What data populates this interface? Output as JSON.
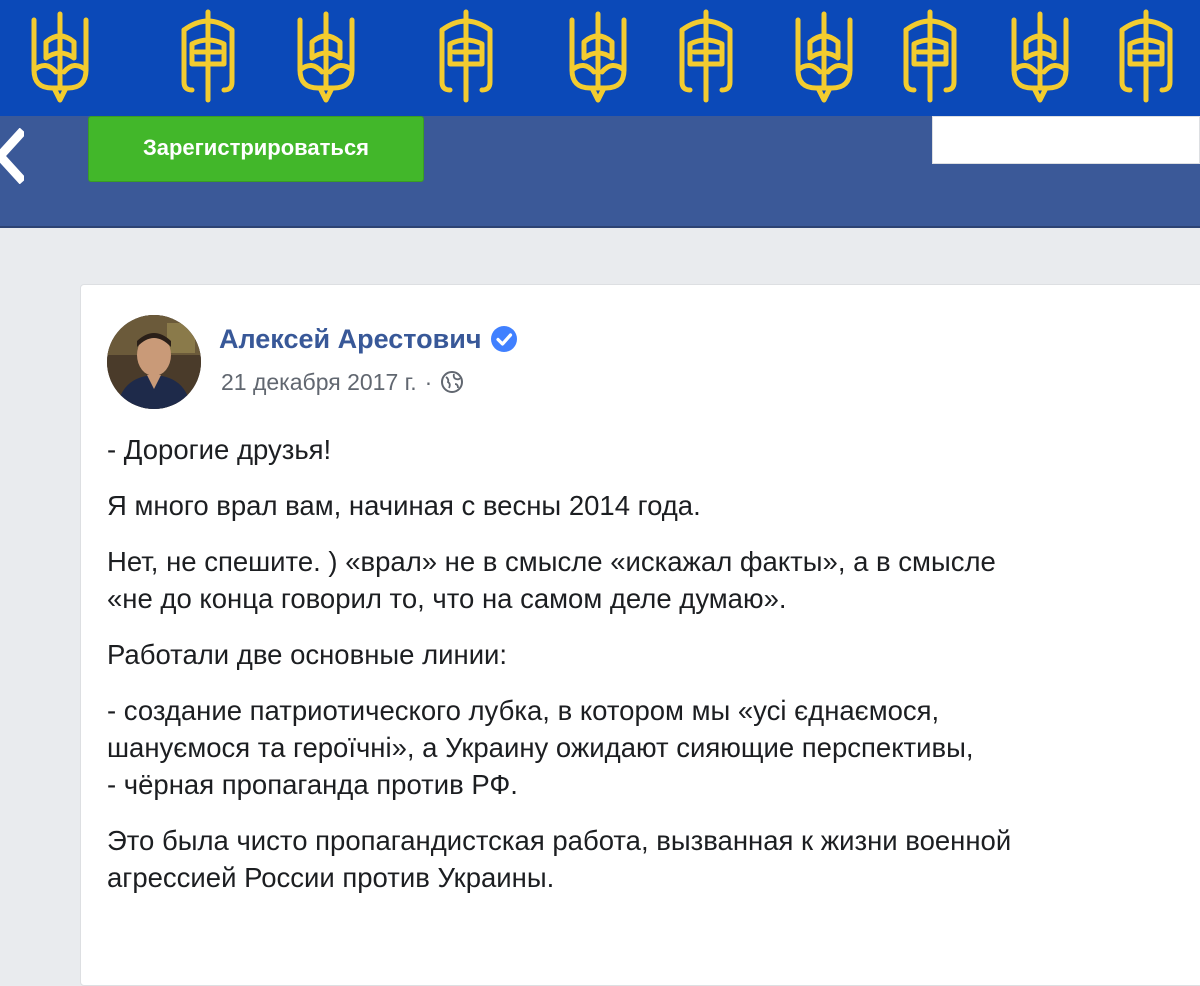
{
  "header": {
    "register_label": "Зарегистрироваться",
    "search_value": "",
    "bar_color": "#3b5998",
    "banner_color": "#0b49b8",
    "emblem_color": "#f3cc2f",
    "register_color": "#42b72a",
    "emblem_icons": [
      "trident-icon",
      "trident-sword-icon"
    ]
  },
  "post": {
    "author": "Алексей Арестович",
    "date": "21 декабря 2017 г.",
    "separator": "·",
    "paragraphs": [
      [
        "- Дорогие друзья!"
      ],
      [
        "Я много врал вам, начиная с весны 2014 года."
      ],
      [
        "Нет, не спешите. ) «врал» не в смысле «искажал факты», а в смысле",
        "«не до конца говорил то, что на самом деле думаю»."
      ],
      [
        "Работали две основные линии:"
      ],
      [
        "- создание патриотического лубка, в котором мы «усі єднаємося,",
        "шануємося та героїчні», а Украину ожидают сияющие перспективы,",
        "- чёрная пропаганда против РФ."
      ],
      [
        "Это была чисто пропагандистская работа, вызванная к жизни военной",
        "агрессией России против Украины."
      ]
    ]
  }
}
